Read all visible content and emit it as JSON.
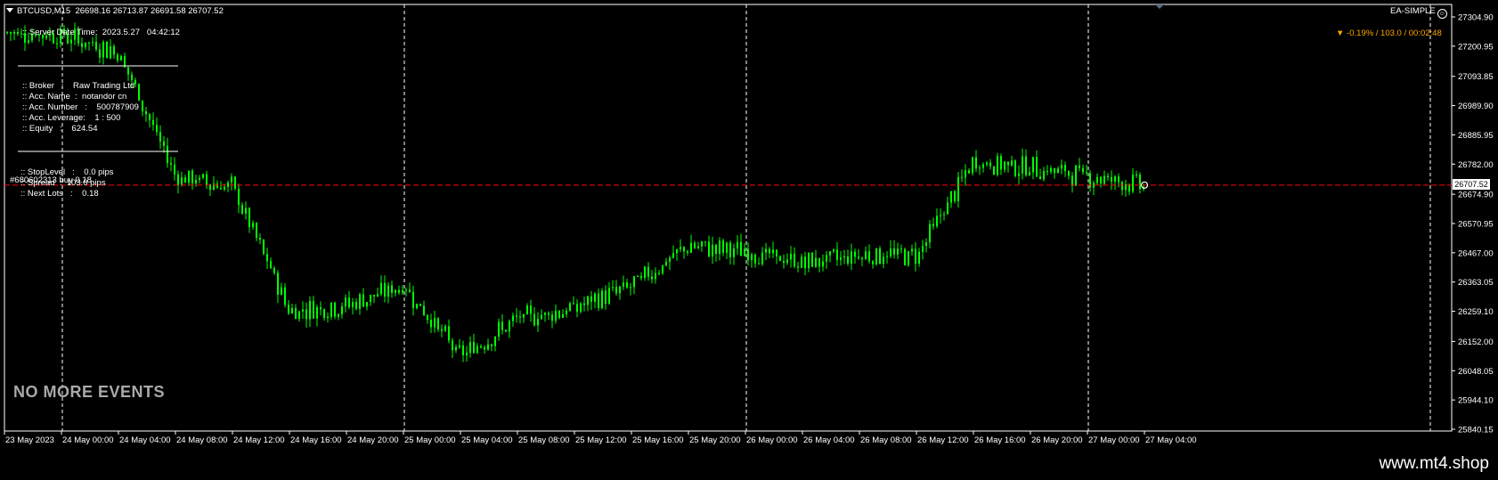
{
  "header": {
    "symbol_line": "BTCUSD,M15  26698.16 26713.87 26691.58 26707.52",
    "ea_name": "EA-SIMPLE",
    "change_text": "▼ -0.19% / 103.0 / 00:02:48"
  },
  "info_panel": {
    "server_time": ":: Server Date Time:  2023.5.27   04:42:12",
    "broker": ":: Broker   :    Raw Trading Ltd",
    "acc_name": ":: Acc. Name  :  notandor cn",
    "acc_number": ":: Acc. Number   :    500787909",
    "acc_leverage": ":: Acc. Leverage:    1 : 500",
    "equity": ":: Equity   :    624.54",
    "stop_level": ":: StopLevel   :    0.0 pips",
    "spread": ":: Spread  :  103.0 pips",
    "next_lots": ":: Next Lots   :    0.18"
  },
  "order_label": "#680602313 buy 0.18",
  "no_events": "NO MORE EVENTS",
  "current_price": "26707.52",
  "watermark": "www.mt4.shop",
  "colors": {
    "candles": "#00ff00",
    "background": "#000000",
    "grid": "#ffffff",
    "price_line": "#ff0000",
    "change_text": "#ffa500"
  },
  "chart_data": {
    "type": "candlestick",
    "symbol": "BTCUSD",
    "timeframe": "M15",
    "y_ticks": [
      "27304.90",
      "27200.95",
      "27093.85",
      "26989.90",
      "26885.95",
      "26782.00",
      "26674.90",
      "26570.95",
      "26467.00",
      "26363.05",
      "26259.10",
      "26152.00",
      "26048.05",
      "25944.10",
      "25840.15"
    ],
    "x_ticks": [
      "23 May 2023",
      "24 May 00:00",
      "24 May 04:00",
      "24 May 08:00",
      "24 May 12:00",
      "24 May 16:00",
      "24 May 20:00",
      "25 May 00:00",
      "25 May 04:00",
      "25 May 08:00",
      "25 May 12:00",
      "25 May 16:00",
      "25 May 20:00",
      "26 May 00:00",
      "26 May 04:00",
      "26 May 08:00",
      "26 May 12:00",
      "26 May 16:00",
      "26 May 20:00",
      "27 May 00:00",
      "27 May 04:00"
    ],
    "ylim": [
      25830,
      27335
    ],
    "price_anchors": [
      {
        "x": "23 May 2023",
        "y": 27250
      },
      {
        "x": "24 May 00:00",
        "y": 27240
      },
      {
        "x": "24 May 04:00",
        "y": 27180
      },
      {
        "x": "24 May 08:00",
        "y": 26740
      },
      {
        "x": "24 May 12:00",
        "y": 26700
      },
      {
        "x": "24 May 16:00",
        "y": 26260
      },
      {
        "x": "24 May 20:00",
        "y": 26280
      },
      {
        "x": "25 May 00:00",
        "y": 26350
      },
      {
        "x": "25 May 04:00",
        "y": 26100
      },
      {
        "x": "25 May 08:00",
        "y": 26230
      },
      {
        "x": "25 May 12:00",
        "y": 26270
      },
      {
        "x": "25 May 16:00",
        "y": 26350
      },
      {
        "x": "25 May 20:00",
        "y": 26490
      },
      {
        "x": "26 May 00:00",
        "y": 26470
      },
      {
        "x": "26 May 04:00",
        "y": 26430
      },
      {
        "x": "26 May 08:00",
        "y": 26460
      },
      {
        "x": "26 May 12:00",
        "y": 26460
      },
      {
        "x": "26 May 16:00",
        "y": 26790
      },
      {
        "x": "26 May 20:00",
        "y": 26770
      },
      {
        "x": "27 May 00:00",
        "y": 26740
      },
      {
        "x": "27 May 04:00",
        "y": 26707
      }
    ]
  }
}
